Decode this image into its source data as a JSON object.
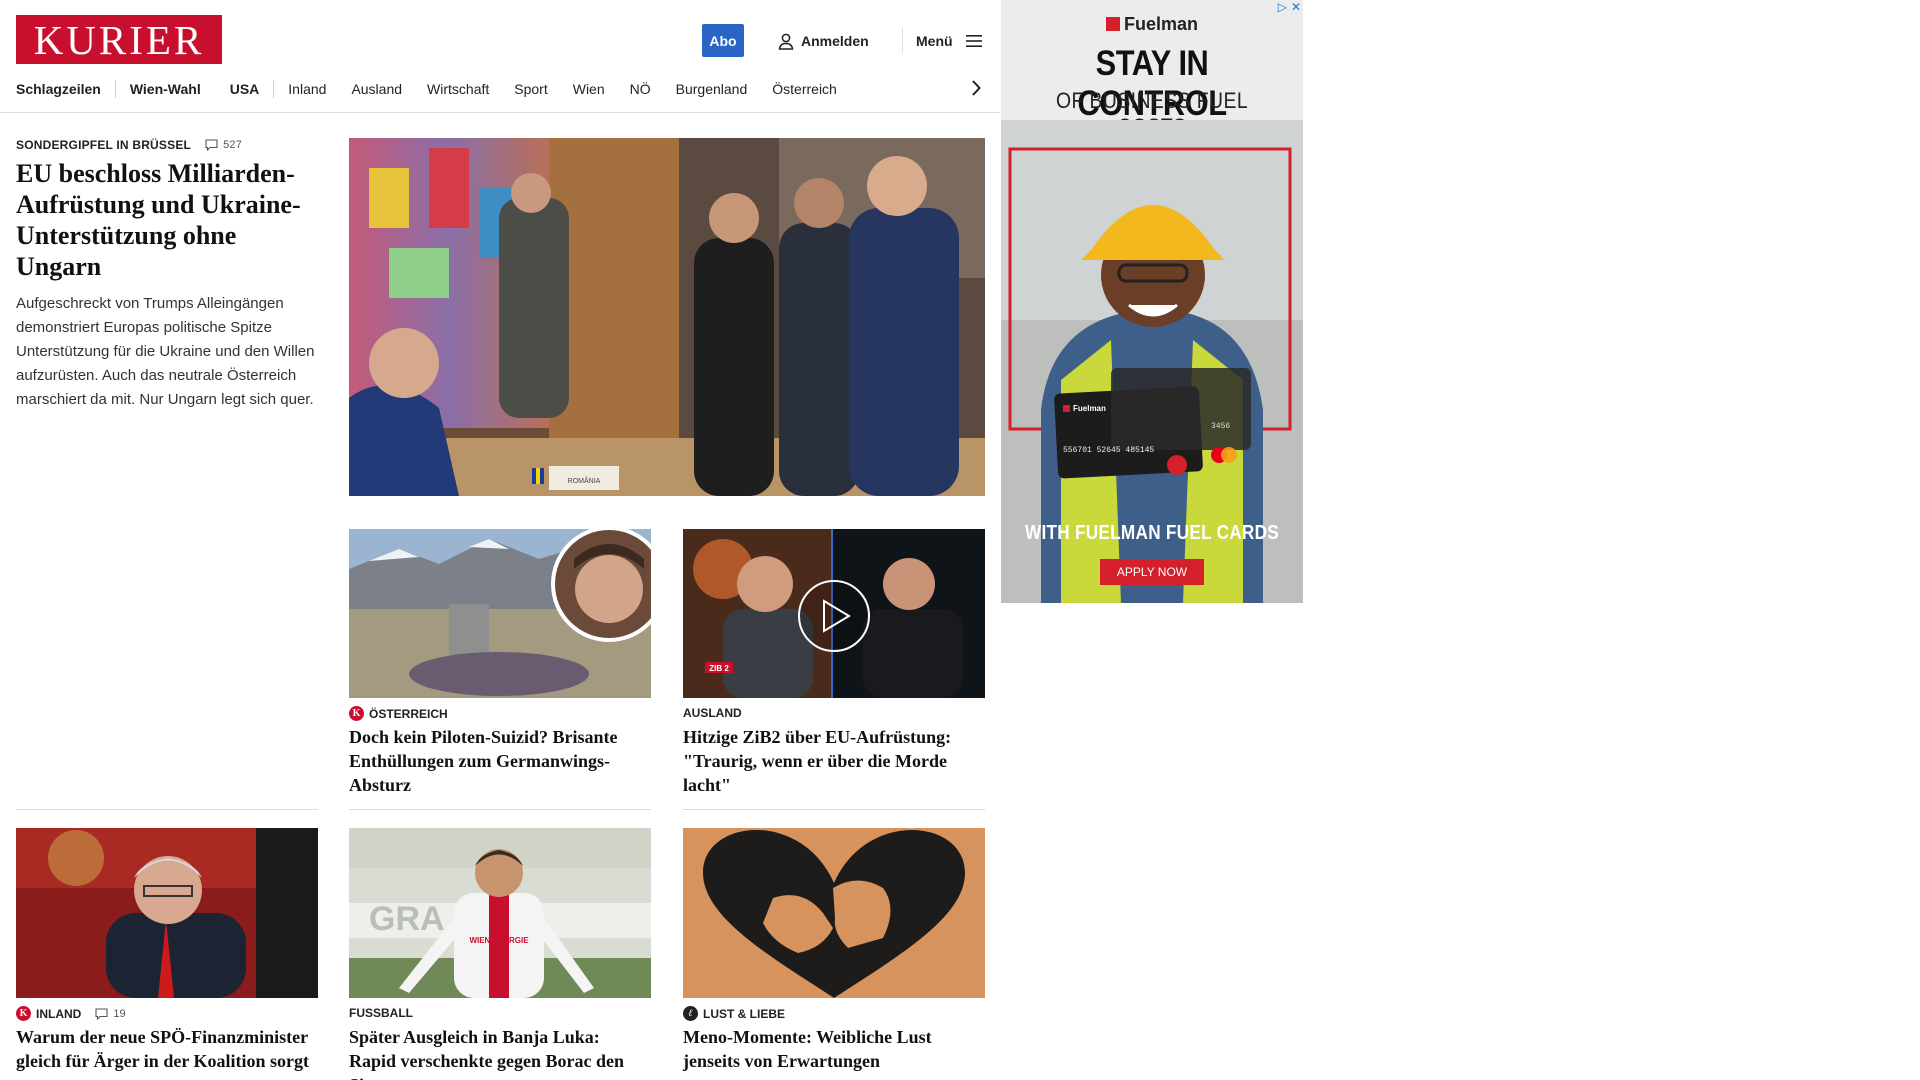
{
  "header": {
    "logo": "KURIER",
    "abo_label": "Abo",
    "login_label": "Anmelden",
    "menu_label": "Menü"
  },
  "nav": {
    "items": [
      "Schlagzeilen",
      "Wien-Wahl",
      "USA",
      "Inland",
      "Ausland",
      "Wirtschaft",
      "Sport",
      "Wien",
      "NÖ",
      "Burgenland",
      "Österreich"
    ]
  },
  "lead": {
    "kicker": "SONDERGIPFEL IN BRÜSSEL",
    "comments": "527",
    "title": "EU beschloss Milliarden-Aufrüstung und Ukraine-Unterstützung ohne Ungarn",
    "teaser": "Aufgeschreckt von Trumps Alleingängen demonstriert Europas politische Spitze Unterstützung für die Ukraine und den Willen aufzurüsten. Auch das neutrale Österreich marschiert da mit. Nur Ungarn legt sich quer.",
    "image_label": "ROMÂNIA"
  },
  "cards": [
    {
      "kicker": "ÖSTERREICH",
      "badge": "K",
      "title": "Doch kein Piloten-Suizid? Brisante Enthüllungen zum Germanwings-Absturz"
    },
    {
      "kicker": "AUSLAND",
      "title": "Hitzige ZiB2 über EU-Aufrüstung: \"Traurig, wenn er über die Morde lacht\"",
      "image_tag": "ZIB 2"
    },
    {
      "kicker": "INLAND",
      "badge": "K",
      "comments": "19",
      "title": "Warum der neue SPÖ-Finanzminister gleich für Ärger in der Koalition sorgt"
    },
    {
      "kicker": "FUSSBALL",
      "title": "Später Ausgleich in Banja Luka: Rapid verschenkte gegen Borac den Sieg",
      "image_text": "GRA      NO L",
      "jersey_text": "WIEN ENERGIE"
    },
    {
      "kicker": "LUST & LIEBE",
      "badge": "ℓ",
      "title": "Meno-Momente: Weibliche Lust jenseits von Erwartungen"
    }
  ],
  "ad": {
    "brand": "Fuelman",
    "headline": "STAY IN CONTROL",
    "subline": "OF BUSINESS FUEL COSTS",
    "cta_text": "WITH FUELMAN FUEL CARDS",
    "button": "APPLY NOW",
    "card_brand": "Fuelman",
    "card_number": "556701 52645 485145",
    "card_num_small": "3456",
    "colors": {
      "brand_red": "#d4202a",
      "vest": "#c9d83a",
      "helmet": "#f2b81d"
    }
  },
  "colors": {
    "kurier_red": "#c8102e",
    "abo_blue": "#2a64c5"
  }
}
